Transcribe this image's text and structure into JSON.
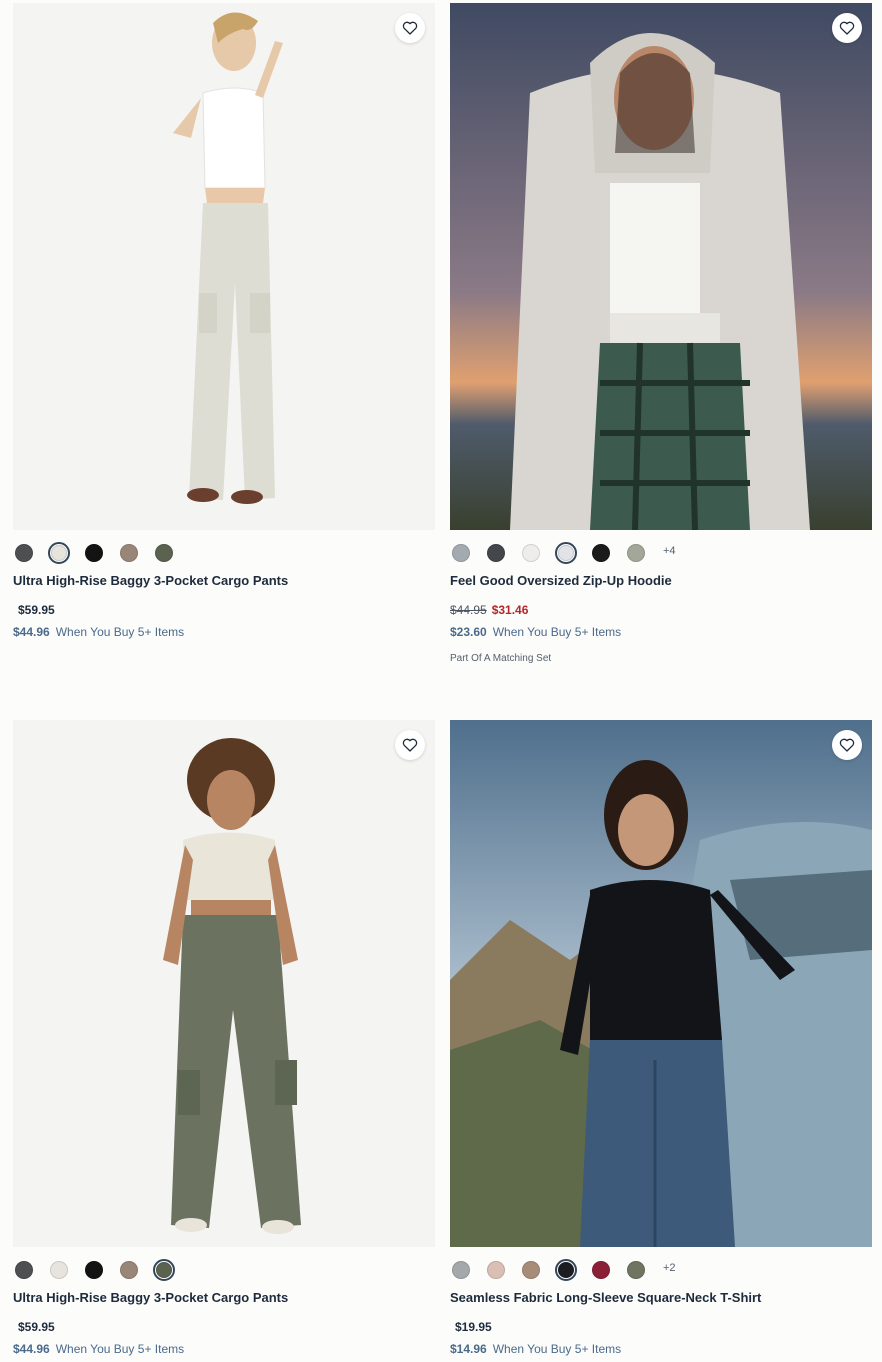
{
  "products": [
    {
      "name": "Ultra High-Rise Baggy 3-Pocket Cargo Pants",
      "price": "$59.95",
      "original_price": "",
      "bulk_price": "$44.96",
      "bulk_text": "When You Buy 5+ Items",
      "tag": "",
      "more_colors": "",
      "selected_swatch": 1,
      "swatches": [
        "#4e4f51",
        "#e6e4dc",
        "#131313",
        "#998679",
        "#5b6250"
      ],
      "image": "woman in beige cargo pants and white crop top, light studio background",
      "wishlist_icon": "heart-icon"
    },
    {
      "name": "Feel Good Oversized Zip-Up Hoodie",
      "price": "$31.46",
      "original_price": "$44.95",
      "bulk_price": "$23.60",
      "bulk_text": "When You Buy 5+ Items",
      "tag": "Part Of A Matching Set",
      "more_colors": "+4",
      "selected_swatch": 3,
      "swatches": [
        "#a3aab0",
        "#45464c",
        "#eeedea",
        "#e2e3e8",
        "#1a1a1a",
        "#a2a79a"
      ],
      "image": "woman in light grey zip-up hoodie and plaid pants at sunset beach",
      "wishlist_icon": "heart-icon"
    },
    {
      "name": "Ultra High-Rise Baggy 3-Pocket Cargo Pants",
      "price": "$59.95",
      "original_price": "",
      "bulk_price": "$44.96",
      "bulk_text": "When You Buy 5+ Items",
      "tag": "",
      "more_colors": "",
      "selected_swatch": 4,
      "swatches": [
        "#4e4f51",
        "#e6e4dc",
        "#131313",
        "#998679",
        "#5b6250"
      ],
      "image": "woman in olive cargo pants and cream tee, light studio background",
      "wishlist_icon": "heart-icon"
    },
    {
      "name": "Seamless Fabric Long-Sleeve Square-Neck T-Shirt",
      "price": "$19.95",
      "original_price": "",
      "bulk_price": "$14.96",
      "bulk_text": "When You Buy 5+ Items",
      "tag": "",
      "more_colors": "+2",
      "selected_swatch": 3,
      "swatches": [
        "#a5a8ab",
        "#d9bfb4",
        "#a78c78",
        "#1b1d22",
        "#8c1f38",
        "#6f7560"
      ],
      "image": "woman in black long-sleeve top and jeans leaning on blue car, mountains",
      "wishlist_icon": "heart-icon"
    }
  ]
}
